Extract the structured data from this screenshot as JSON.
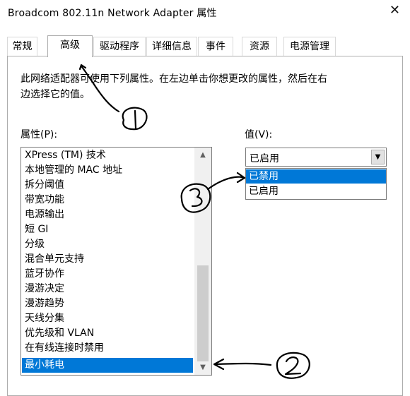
{
  "window": {
    "title": "Broadcom 802.11n Network Adapter 属性"
  },
  "tabs": [
    {
      "label": "常规"
    },
    {
      "label": "高级"
    },
    {
      "label": "驱动程序"
    },
    {
      "label": "详细信息"
    },
    {
      "label": "事件"
    },
    {
      "label": "资源"
    },
    {
      "label": "电源管理"
    }
  ],
  "active_tab": "高级",
  "description": {
    "line1": "此网络适配器可使用下列属性。在左边单击你想更改的属性，然后在右",
    "line2": "边选择它的值。"
  },
  "property": {
    "label": "属性(P):",
    "items": [
      "XPress (TM) 技术",
      "本地管理的 MAC 地址",
      "拆分阈值",
      "带宽功能",
      "电源输出",
      "短 GI",
      "分级",
      "混合单元支持",
      "蓝牙协作",
      "漫游决定",
      "漫游趋势",
      "天线分集",
      "优先级和 VLAN",
      "在有线连接时禁用",
      "最小耗电"
    ],
    "selected": "最小耗电"
  },
  "value": {
    "label": "值(V):",
    "current": "已启用",
    "options": [
      "已禁用",
      "已启用"
    ],
    "highlighted": "已禁用"
  },
  "annotations": {
    "marks": [
      "1",
      "2",
      "3"
    ]
  },
  "colors": {
    "selection": "#0078d7",
    "annotation": "#000000"
  }
}
